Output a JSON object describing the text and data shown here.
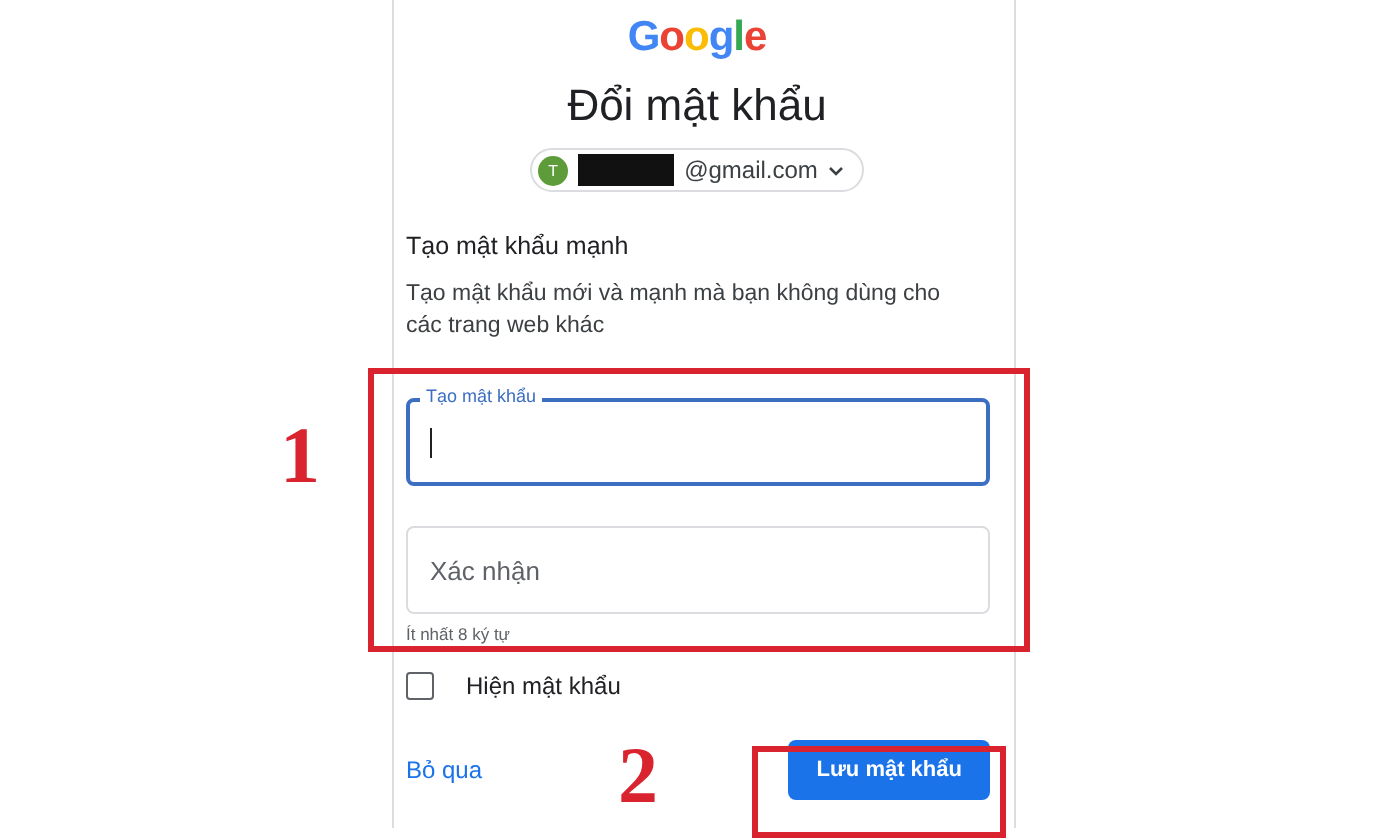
{
  "logo": "Google",
  "title": "Đổi mật khẩu",
  "account": {
    "avatar": "T",
    "email": "@gmail.com",
    "redacted": true
  },
  "heading": "Tạo mật khẩu mạnh",
  "description": "Tạo mật khẩu mới và mạnh mà bạn không dùng cho các trang web khác",
  "fields": [
    {
      "label": "Tạo mật khẩu",
      "focused": true
    },
    {
      "placeholder": "Xác nhận",
      "focused": false
    }
  ],
  "hint": "Ít nhất 8 ký tự",
  "show_password": {
    "label": "Hiện mật khẩu",
    "checked": false
  },
  "skip_link": "Bỏ qua",
  "save_button": "Lưu mật khẩu",
  "annotations": [
    {
      "number": "1"
    },
    {
      "number": "2"
    }
  ]
}
